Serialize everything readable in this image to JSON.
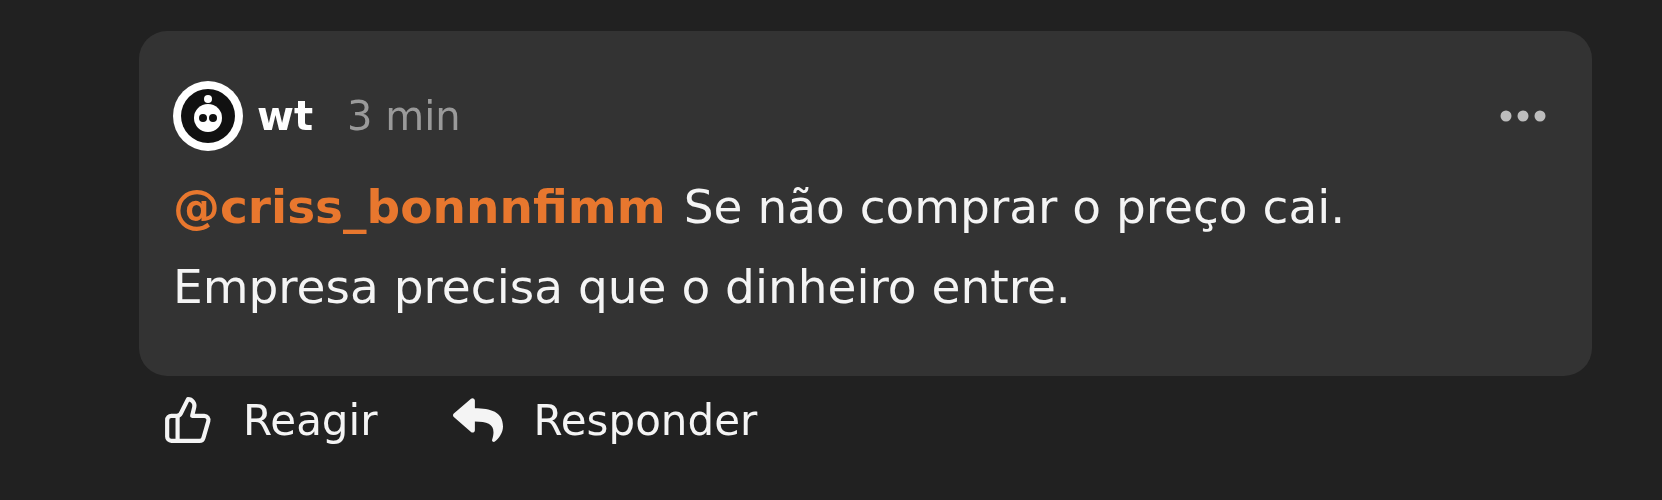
{
  "comment": {
    "author": "wt",
    "time": "3 min",
    "mention": "@criss_bonnnfimm",
    "text": "Se não comprar o preço cai. Empresa precisa que o dinheiro entre."
  },
  "actions": [
    {
      "kind": "react",
      "label": "Reagir"
    },
    {
      "kind": "reply",
      "label": "Responder"
    }
  ]
}
